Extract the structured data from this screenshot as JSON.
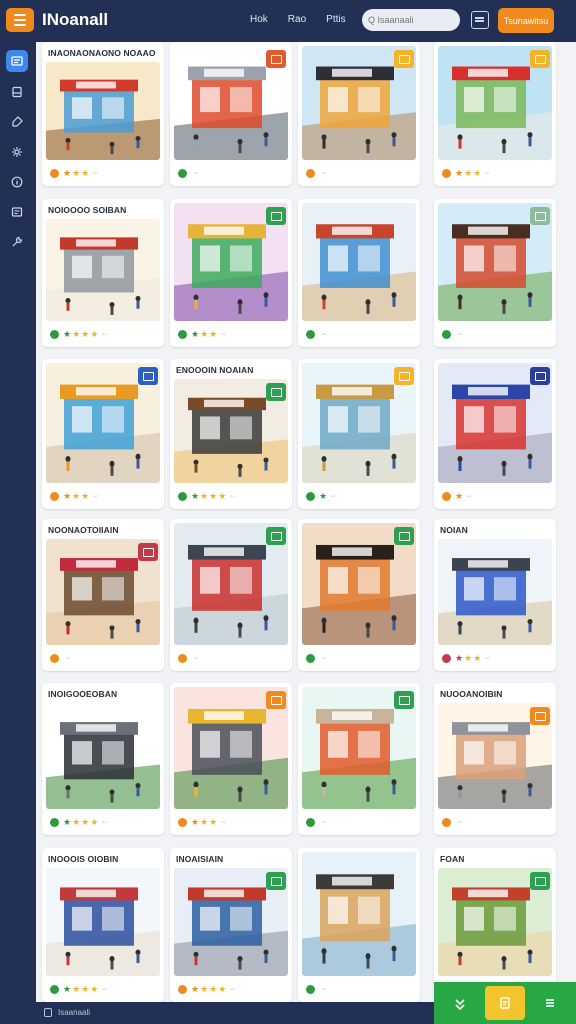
{
  "app": {
    "title": "INoanall"
  },
  "nav": {
    "links": [
      "Hok",
      "Rao",
      "Pttis"
    ]
  },
  "search": {
    "placeholder": "Q Isaanaali"
  },
  "header": {
    "cta_label": "Tsunawitsu"
  },
  "sidebar": {
    "items": [
      {
        "icon": "store-icon",
        "active": true
      },
      {
        "icon": "inventory-icon",
        "active": false
      },
      {
        "icon": "tag-icon",
        "active": false
      },
      {
        "icon": "settings-icon",
        "active": false
      },
      {
        "icon": "info-icon",
        "active": false
      },
      {
        "icon": "report-icon",
        "active": false
      },
      {
        "icon": "tools-icon",
        "active": false
      }
    ]
  },
  "grid": {
    "cards": [
      {
        "title": "INAONAONAONO NOAAO",
        "rating": 3,
        "rating_color": "#f08a1c",
        "badge": "",
        "scene": "mall"
      },
      {
        "title": "",
        "rating": 0,
        "rating_color": "#2a9c3e",
        "badge": "#e25b2f",
        "scene": "machine"
      },
      {
        "title": "",
        "rating": 0,
        "rating_color": "#f08a1c",
        "badge": "#f5b32c",
        "scene": "storefront"
      },
      {
        "title": "",
        "rating": 3,
        "rating_color": "#f08a1c",
        "badge": "#f5b32c",
        "scene": "house"
      },
      {
        "title": "NOIOOOO SOIBAN",
        "rating": 4,
        "rating_color": "#2a9c3e",
        "badge": "",
        "scene": "booth"
      },
      {
        "title": "",
        "rating": 3,
        "rating_color": "#2a9c3e",
        "badge": "#2f9f52",
        "scene": "colorful"
      },
      {
        "title": "",
        "rating": 0,
        "rating_color": "#2a9c3e",
        "badge": "",
        "scene": "stalls"
      },
      {
        "title": "",
        "rating": 0,
        "rating_color": "#2a9c3e",
        "badge": "#8bbd9b",
        "scene": "shop"
      },
      {
        "title": "",
        "rating": 3,
        "rating_color": "#f08a1c",
        "badge": "#2a5fc4",
        "scene": "kiosk"
      },
      {
        "title": "ENOOOIN NOAIAN",
        "rating": 4,
        "rating_color": "#2a9c3e",
        "badge": "#2f9f52",
        "scene": "street"
      },
      {
        "title": "",
        "rating": 1,
        "rating_color": "#2a9c3e",
        "badge": "#f5b32c",
        "scene": "market"
      },
      {
        "title": "",
        "rating": 1,
        "rating_color": "#f08a1c",
        "badge": "#2a3f9e",
        "scene": "glass"
      },
      {
        "title": "NOONAOTOIIAIN",
        "rating": 0,
        "rating_color": "#f08a1c",
        "badge": "#c23a4a",
        "scene": "red"
      },
      {
        "title": "",
        "rating": 0,
        "rating_color": "#f08a1c",
        "badge": "#2f9f52",
        "scene": "arcade"
      },
      {
        "title": "",
        "rating": 0,
        "rating_color": "#2a9c3e",
        "badge": "#2f9f52",
        "scene": "dark"
      },
      {
        "title": "NOIAN",
        "rating": 3,
        "rating_color": "#c23a4a",
        "badge": "",
        "scene": "counter"
      },
      {
        "title": "INOIGOOEOBAN",
        "rating": 4,
        "rating_color": "#2a9c3e",
        "badge": "",
        "scene": "device"
      },
      {
        "title": "",
        "rating": 3,
        "rating_color": "#f08a1c",
        "badge": "#f08a1c",
        "scene": "cabinet"
      },
      {
        "title": "",
        "rating": 0,
        "rating_color": "#2a9c3e",
        "badge": "#2f9f52",
        "scene": "stand"
      },
      {
        "title": "NUOOANOIBIN",
        "rating": 0,
        "rating_color": "#f08a1c",
        "badge": "#f08a1c",
        "scene": "cube"
      },
      {
        "title": "INOOOIS OIOBIN",
        "rating": 4,
        "rating_color": "#2a9c3e",
        "badge": "",
        "scene": "pavilion"
      },
      {
        "title": "INOAISIAIN",
        "rating": 4,
        "rating_color": "#f08a1c",
        "badge": "#2f9f52",
        "scene": "plaza"
      },
      {
        "title": "",
        "rating": 0,
        "rating_color": "#2a9c3e",
        "badge": "",
        "scene": "hut"
      },
      {
        "title": "FOAN",
        "rating": 0,
        "rating_color": "#2a9c3e",
        "badge": "#2f9f52",
        "scene": "green"
      }
    ]
  },
  "footer": {
    "page_label": "Isaanaali"
  },
  "dock": {
    "buttons": [
      "expand-icon",
      "edit-icon",
      "list-icon"
    ]
  }
}
